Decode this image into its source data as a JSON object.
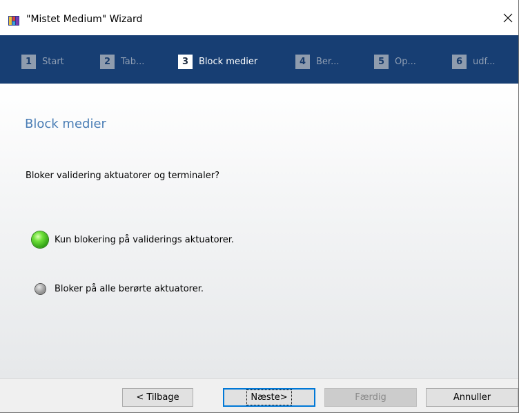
{
  "window": {
    "title": "\"Mistet Medium\" Wizard",
    "app_icon": "wizard-app-icon",
    "close_icon": "close-icon"
  },
  "steps": [
    {
      "number": "1",
      "label": "Start",
      "active": false
    },
    {
      "number": "2",
      "label": "Tab...",
      "active": false
    },
    {
      "number": "3",
      "label": "Block medier",
      "active": true
    },
    {
      "number": "4",
      "label": "Ber...",
      "active": false
    },
    {
      "number": "5",
      "label": "Op...",
      "active": false
    },
    {
      "number": "6",
      "label": "udf...",
      "active": false
    }
  ],
  "main": {
    "heading": "Block medier",
    "question": "Bloker validering aktuatorer og terminaler?",
    "options": [
      {
        "label": "Kun blokering på validerings aktuatorer.",
        "selected": true
      },
      {
        "label": "Bloker på alle berørte aktuatorer.",
        "selected": false
      }
    ]
  },
  "footer": {
    "back_label": "< Tilbage",
    "next_label": "Næste>",
    "finish_label": "Færdig",
    "cancel_label": "Annuller"
  },
  "colors": {
    "stepbar_bg": "#173e73",
    "heading": "#4a7db5",
    "selected_radio": "#3cc21c"
  }
}
